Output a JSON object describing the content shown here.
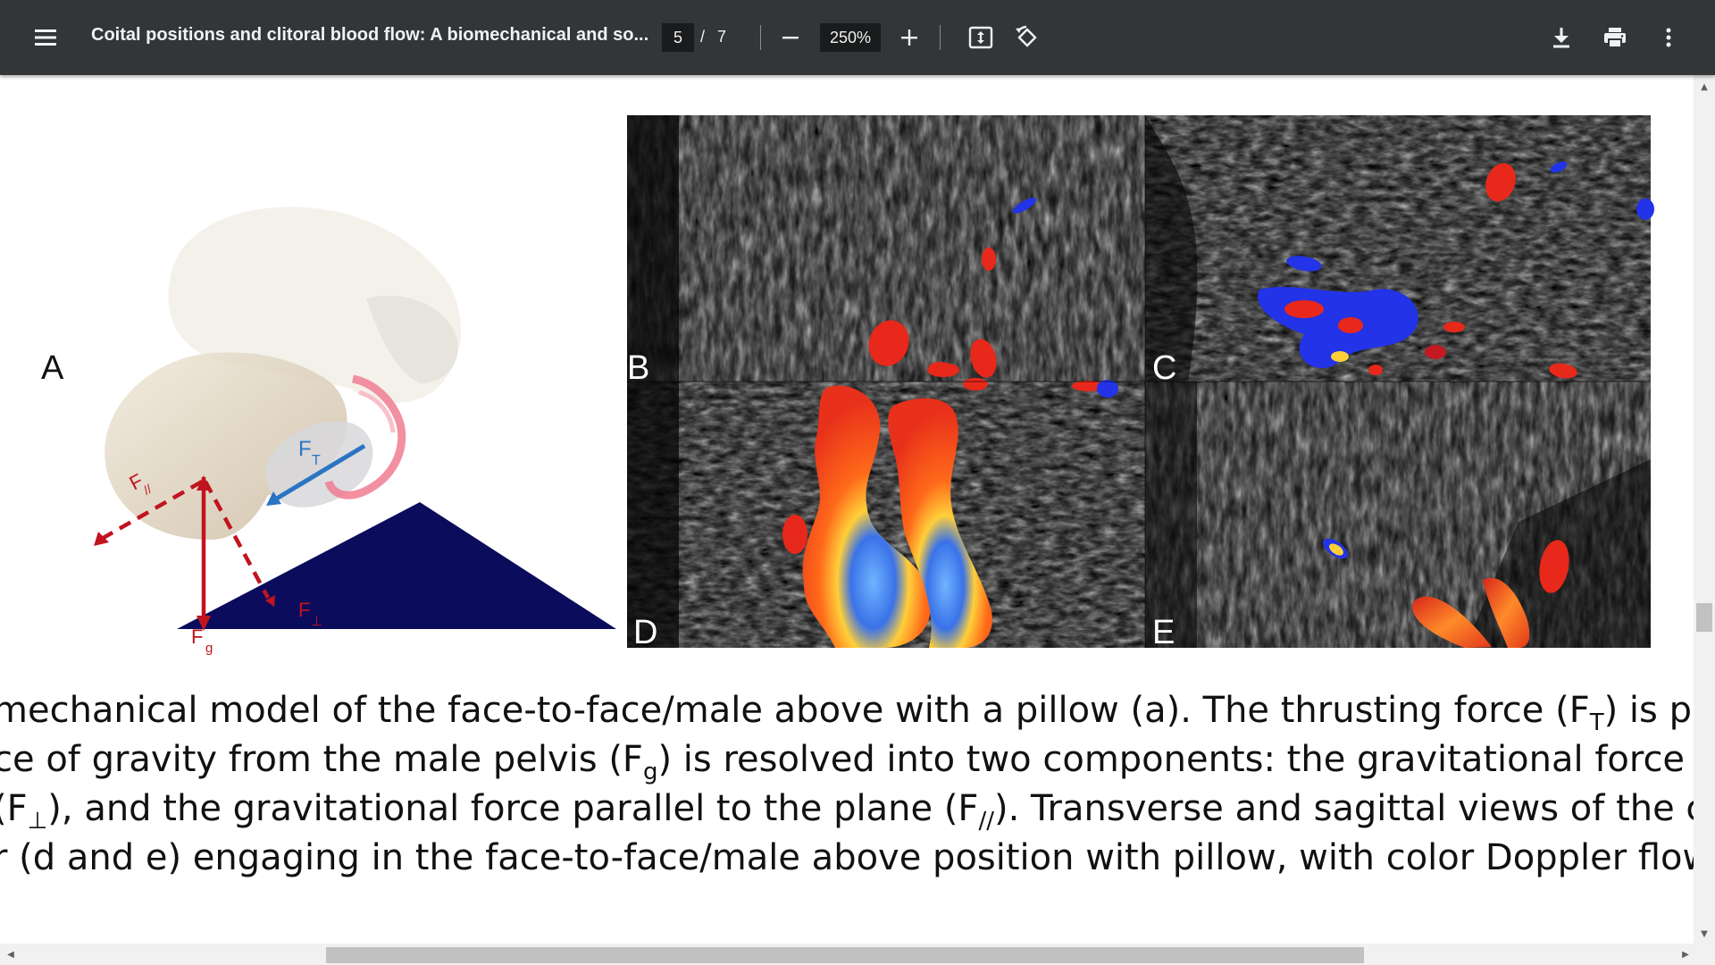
{
  "toolbar": {
    "menu_icon": "hamburger-menu-icon",
    "title": "Coital positions and clitoral blood flow: A biomechanical and so...",
    "page_current": "5",
    "page_separator": "/",
    "page_total": "7",
    "zoom": "250%",
    "zoom_out_icon": "minus-icon",
    "zoom_in_icon": "plus-icon",
    "fit_icon": "fit-to-page-icon",
    "rotate_icon": "rotate-icon",
    "download_icon": "download-icon",
    "print_icon": "print-icon",
    "more_icon": "more-vertical-icon"
  },
  "figure": {
    "panel_a_label": "A",
    "panel_b_label": "B",
    "panel_c_label": "C",
    "panel_d_label": "D",
    "panel_e_label": "E",
    "force_thrust": "F",
    "force_thrust_sub": "T",
    "force_parallel": "F",
    "force_parallel_sub": "//",
    "force_gravity": "F",
    "force_gravity_sub": "g",
    "force_perp": "F",
    "force_perp_sub": "⊥"
  },
  "caption": {
    "l1_a": "mechanical model of the face-to-face/male above with a pillow (a). The thrusting force (F",
    "l1_sub": "T",
    "l1_b": ") is provic",
    "l2_a": "ce of gravity from the male pelvis (F",
    "l2_sub": "g",
    "l2_b": ") is resolved into two components: the gravitational force perpe",
    "l3_a": "(F",
    "l3_sub": "⊥",
    "l3_b": "), and the gravitational force parallel to the plane (F",
    "l3_sub2": "//",
    "l3_c": "). Transverse and sagittal views of the cl",
    "l4": "r (d and e) engaging in the face-to-face/male above position with pillow, with color Doppler flow."
  },
  "colors": {
    "toolbar_bg": "#323639",
    "force_red": "#c0141e",
    "force_blue": "#2a74c4",
    "plane_navy": "#0c0c5c"
  }
}
